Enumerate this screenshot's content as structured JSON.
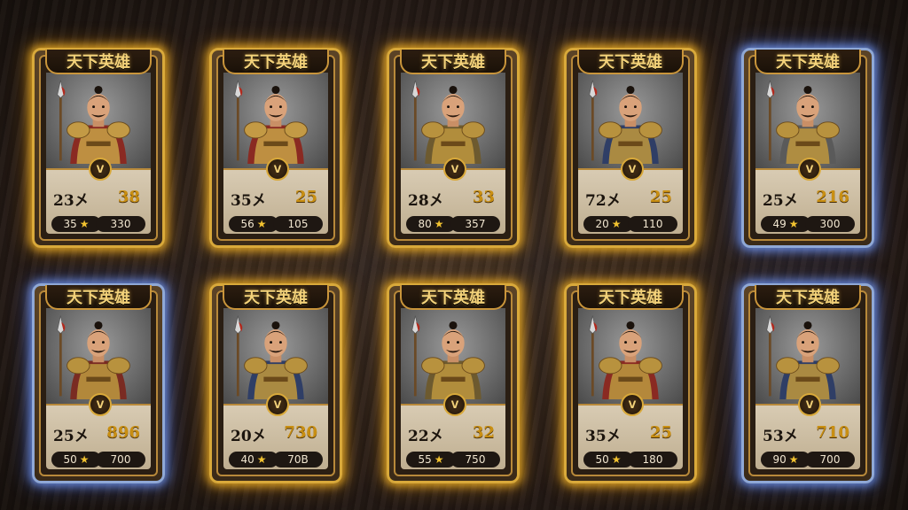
{
  "cards": [
    {
      "title": "天下英雄",
      "frame": "gold",
      "left_stat": "23㐅",
      "right_stat": "38",
      "stars": "35",
      "power": "330",
      "emblem": "ᐯ"
    },
    {
      "title": "天下英雄",
      "frame": "gold",
      "left_stat": "35㐅",
      "right_stat": "25",
      "stars": "56",
      "power": "105",
      "emblem": "ᐯ"
    },
    {
      "title": "天下英雄",
      "frame": "gold",
      "left_stat": "28㐅",
      "right_stat": "33",
      "stars": "80",
      "power": "357",
      "emblem": "ᐯ"
    },
    {
      "title": "天下英雄",
      "frame": "gold",
      "left_stat": "72㐅",
      "right_stat": "25",
      "stars": "20",
      "power": "110",
      "emblem": "ᐯ"
    },
    {
      "title": "天下英雄",
      "frame": "blue",
      "left_stat": "25㐅",
      "right_stat": "216",
      "stars": "49",
      "power": "300",
      "emblem": "ᐯ"
    },
    {
      "title": "天下英雄",
      "frame": "blue",
      "left_stat": "25㐅",
      "right_stat": "896",
      "stars": "50",
      "power": "700",
      "emblem": "ᐯ"
    },
    {
      "title": "天下英雄",
      "frame": "gold",
      "left_stat": "20㐅",
      "right_stat": "730",
      "stars": "40",
      "power": "70B",
      "emblem": "ᐯ"
    },
    {
      "title": "天下英雄",
      "frame": "gold",
      "left_stat": "22㐅",
      "right_stat": "32",
      "stars": "55",
      "power": "750",
      "emblem": "ᐯ"
    },
    {
      "title": "天下英雄",
      "frame": "gold",
      "left_stat": "35㐅",
      "right_stat": "25",
      "stars": "50",
      "power": "180",
      "emblem": "ᐯ"
    },
    {
      "title": "天下英雄",
      "frame": "blue",
      "left_stat": "53㐅",
      "right_stat": "710",
      "stars": "90",
      "power": "700",
      "emblem": "ᐯ"
    }
  ],
  "icons": {
    "star": "star-icon",
    "emblem": "shield-emblem-icon",
    "portrait": "warrior-portrait"
  },
  "colors": {
    "gold_glow": "#ffbe28",
    "blue_glow": "#78a0ff",
    "title_text": "#f3d27a",
    "accent_stat": "#c98f12"
  }
}
